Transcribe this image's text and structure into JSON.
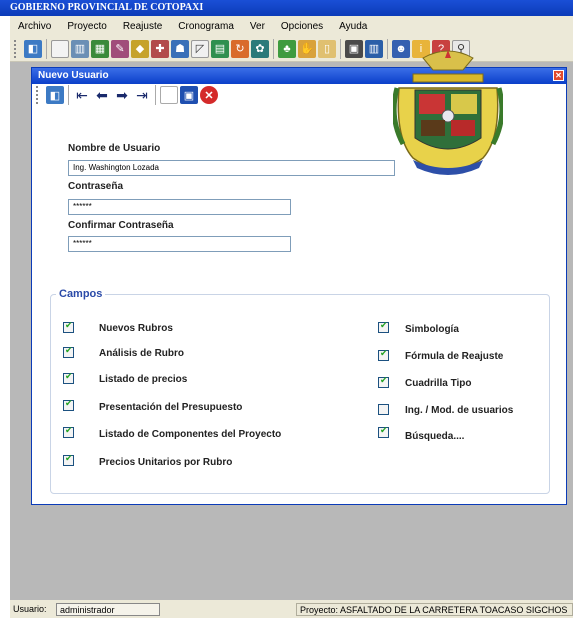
{
  "app": {
    "title": "GOBIERNO PROVINCIAL DE COTOPAXI",
    "menu": [
      "Archivo",
      "Proyecto",
      "Reajuste",
      "Cronograma",
      "Ver",
      "Opciones",
      "Ayuda"
    ]
  },
  "window": {
    "title": "Nuevo Usuario"
  },
  "form": {
    "username_label": "Nombre de Usuario",
    "username_value": "Ing. Washington Lozada",
    "password_label": "Contraseña",
    "password_value": "******",
    "confirm_label": "Confirmar Contraseña",
    "confirm_value": "******"
  },
  "campos": {
    "legend": "Campos",
    "left": [
      {
        "label": "Nuevos Rubros",
        "checked": true
      },
      {
        "label": "Análisis de Rubro",
        "checked": true
      },
      {
        "label": "Listado de precios",
        "checked": true
      },
      {
        "label": "Presentación del Presupuesto",
        "checked": true
      },
      {
        "label": "Listado de Componentes del Proyecto",
        "checked": true
      },
      {
        "label": "Precios Unitarios por Rubro",
        "checked": true
      }
    ],
    "right": [
      {
        "label": "Simbología",
        "checked": true
      },
      {
        "label": "Fórmula de Reajuste",
        "checked": true
      },
      {
        "label": "Cuadrilla Tipo",
        "checked": true
      },
      {
        "label": "Ing. / Mod. de usuarios",
        "checked": false
      },
      {
        "label": "Búsqueda....",
        "checked": true
      }
    ]
  },
  "status": {
    "user_label": "Usuario:",
    "user_value": "administrador",
    "project_text": "Proyecto: ASFALTADO DE LA CARRETERA TOACASO SIGCHOS"
  },
  "colors": {
    "title_bar": "#0b3bb8",
    "fieldset_legend": "#2a4aa8",
    "check": "#21a121",
    "mdi_background": "#b8b8b8"
  }
}
